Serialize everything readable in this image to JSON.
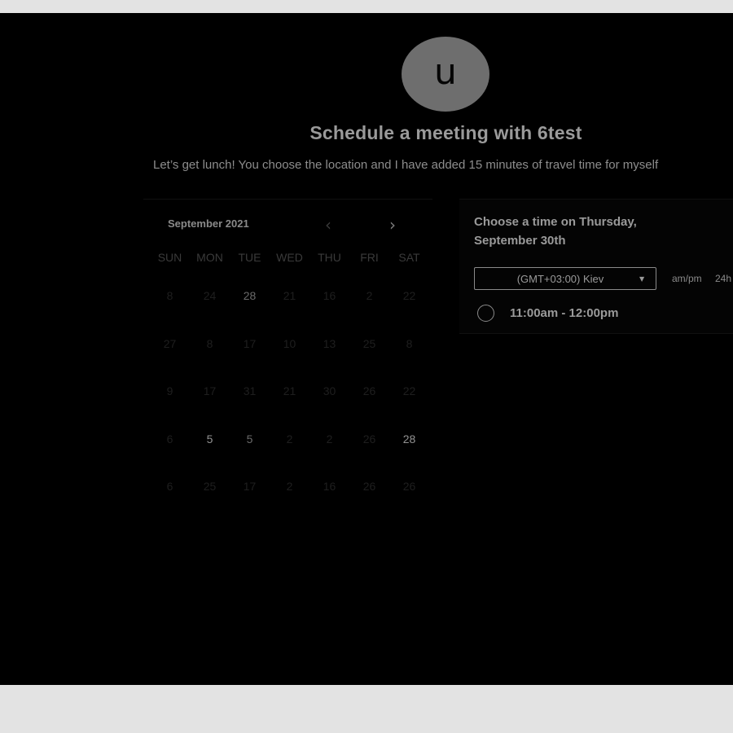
{
  "host": {
    "avatar_letter": "u",
    "title": "Schedule a meeting with 6test"
  },
  "description": "Let’s get lunch! You choose the location and I have added 15 minutes of travel time for myself",
  "calendar": {
    "month_label": "September 2021",
    "prev_icon": "‹",
    "next_icon": "›",
    "weekdays": [
      "SUN",
      "MON",
      "TUE",
      "WED",
      "THU",
      "FRI",
      "SAT"
    ],
    "weeks": [
      [
        "8",
        "24",
        "28",
        "21",
        "16",
        "2",
        "22"
      ],
      [
        "27",
        "8",
        "17",
        "10",
        "13",
        "25",
        "8"
      ],
      [
        "9",
        "17",
        "31",
        "21",
        "30",
        "26",
        "22"
      ],
      [
        "6",
        "5",
        "5",
        "2",
        "2",
        "26",
        "28"
      ],
      [
        "6",
        "25",
        "17",
        "2",
        "16",
        "26",
        "26"
      ]
    ]
  },
  "time_panel": {
    "title": "Choose a time on Thursday, September 30th",
    "timezone": "(GMT+03:00) Kiev",
    "format_ampm": "am/pm",
    "format_24h": "24h",
    "slots": [
      "11:00am - 12:00pm"
    ]
  },
  "colors": {
    "background": "#000000",
    "text": "#9a9a9a",
    "frame": "#e3e3e3"
  }
}
